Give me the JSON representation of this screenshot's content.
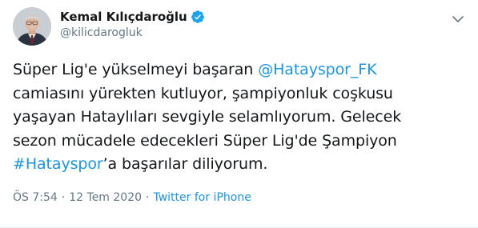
{
  "author": {
    "display_name": "Kemal Kılıçdaroğlu",
    "handle": "@kilicdarogluk",
    "verified": true
  },
  "tweet": {
    "line1_prefix": "Süper Lig'e yükselmeyi başaran ",
    "mention": "@Hatayspor_FK",
    "line2": "camiasını yürekten kutluyor, şampiyonluk coşkusu",
    "line3": "yaşayan Hataylıları sevgiyle selamlıyorum. Gelecek",
    "line4": "sezon mücadele edecekleri Süper Lig'de Şampiyon",
    "hashtag": "#Hatayspor",
    "line5_suffix": "’a başarılar diliyorum."
  },
  "meta": {
    "time": "ÖS 7:54",
    "separator1": "·",
    "date": "12 Tem 2020",
    "separator2": "·",
    "source": "Twitter for iPhone"
  },
  "icons": {
    "verified": "verified-badge-icon",
    "caret": "chevron-down-icon"
  },
  "colors": {
    "link": "#1b95e0",
    "muted": "#657786",
    "text": "#14171a",
    "verified": "#1da1f2"
  }
}
